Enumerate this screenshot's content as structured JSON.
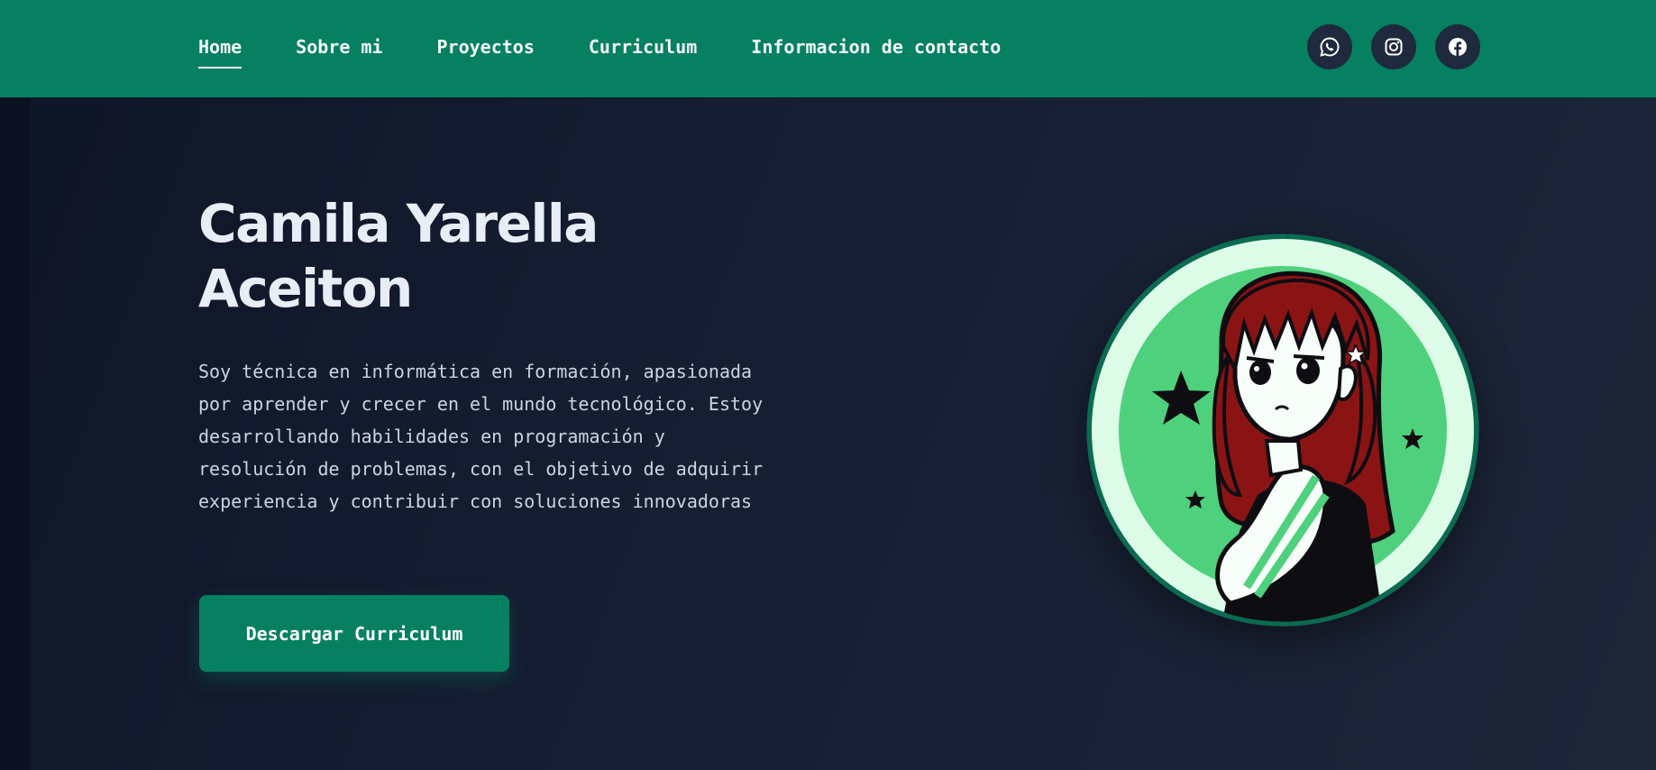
{
  "nav": {
    "items": [
      {
        "label": "Home",
        "active": true
      },
      {
        "label": "Sobre mi",
        "active": false
      },
      {
        "label": "Proyectos",
        "active": false
      },
      {
        "label": "Curriculum",
        "active": false
      },
      {
        "label": "Informacion de contacto",
        "active": false
      }
    ]
  },
  "socials": [
    {
      "icon": "whatsapp-icon"
    },
    {
      "icon": "instagram-icon"
    },
    {
      "icon": "facebook-icon"
    }
  ],
  "hero": {
    "name": "Camila Yarella Aceiton",
    "description": "Soy técnica en informática en formación, apasionada por aprender y crecer en el mundo tecnológico. Estoy desarrollando habilidades en programación y resolución de problemas, con el objetivo de adquirir experiencia y contribuir con soluciones innovadoras",
    "cta_label": "Descargar Curriculum"
  },
  "avatar": {
    "icon": "profile-avatar-illustration"
  },
  "colors": {
    "header": "#068061",
    "background": "#0f172a",
    "accent": "#068061",
    "avatar_ring": "#0b6b50",
    "avatar_light": "#dcfce7",
    "avatar_green": "#4fd07d",
    "hair": "#8a1414"
  }
}
